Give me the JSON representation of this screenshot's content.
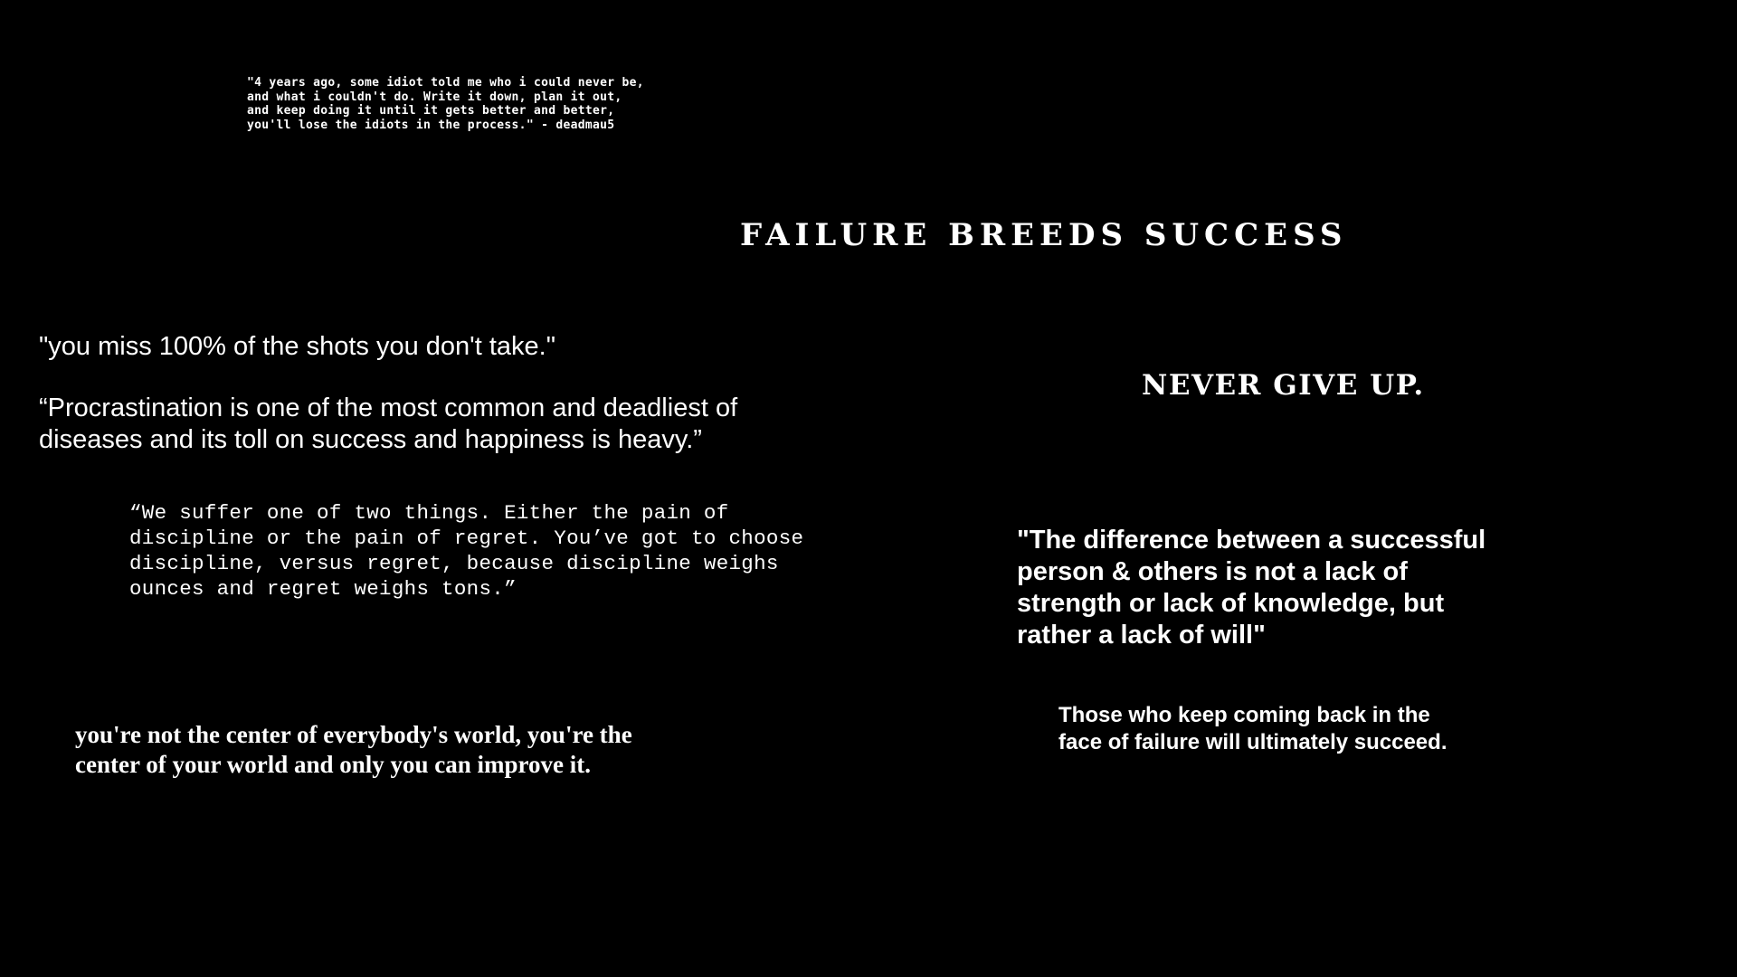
{
  "wallpaper": {
    "background_color": "#000000",
    "text_color": "#ffffff",
    "headings": {
      "failure_breeds_success": "FAILURE BREEDS SUCCESS",
      "never_give_up": "NEVER GIVE UP."
    },
    "quotes": {
      "deadmau5": "\"4 years ago, some idiot told me who i could never be,\nand what i couldn't do. Write it down, plan it out,\nand keep doing it until it gets better and better,\nyou'll lose the idiots in the process.\" - deadmau5",
      "shots": "\"you miss 100% of the shots you don't take.\"",
      "procrastination": "“Procrastination is one of the most common and deadliest of\ndiseases and its toll on success and happiness is heavy.”",
      "discipline": "“We suffer one of two things. Either the pain of\ndiscipline or the pain of regret. You’ve got to choose\ndiscipline, versus regret, because discipline weighs\nounces and regret weighs tons.”",
      "center_of_world": "you're not the center of everybody's world, you're the\ncenter of your world and only you can improve it.",
      "difference": "\"The difference between a successful\nperson & others is not a lack of\nstrength or lack of knowledge, but\nrather a lack of will\"",
      "coming_back": "Those who keep coming back in the\nface of failure will ultimately succeed."
    }
  }
}
